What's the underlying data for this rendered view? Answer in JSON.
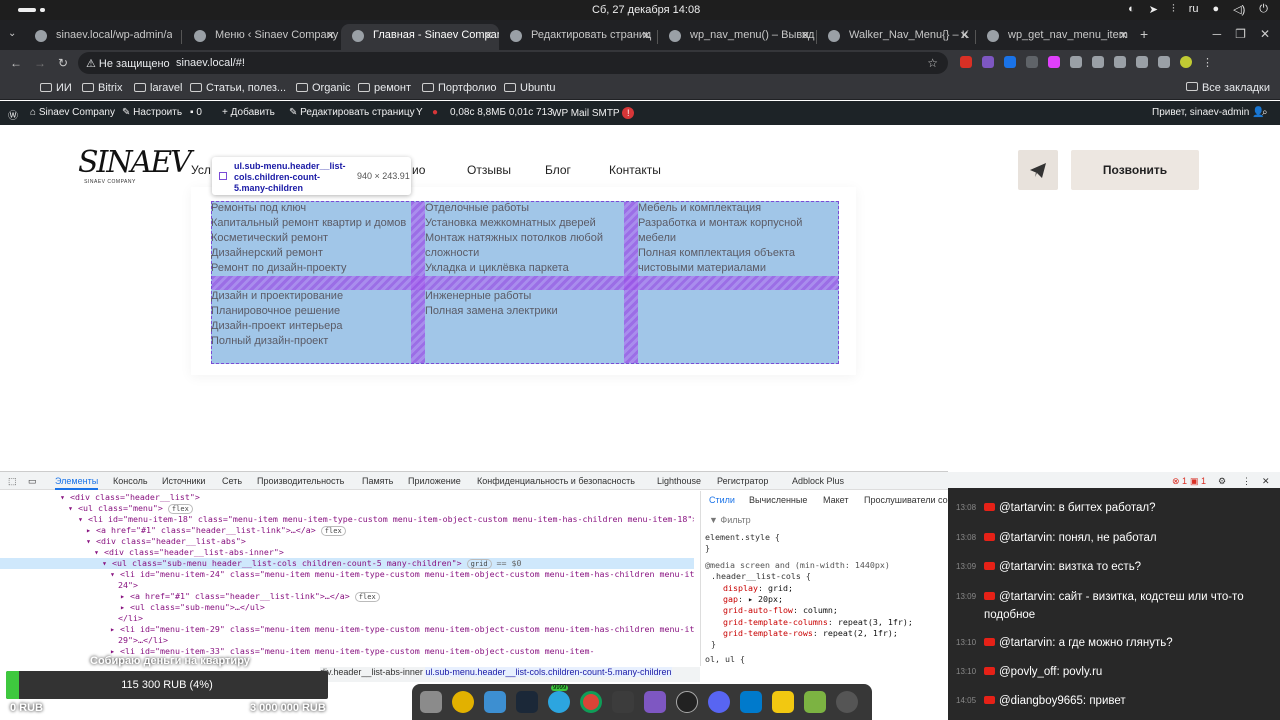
{
  "os": {
    "clock": "Сб, 27 декабря  14:08",
    "lang": "ru"
  },
  "browser": {
    "tabs": [
      {
        "label": "sinaev.local/wp-admin/ad"
      },
      {
        "label": "Меню ‹ Sinaev Company"
      },
      {
        "label": "Главная - Sinaev Compan"
      },
      {
        "label": "Редактировать страниц"
      },
      {
        "label": "wp_nav_menu() – Вывод"
      },
      {
        "label": "Walker_Nav_Menu{} – K"
      },
      {
        "label": "wp_get_nav_menu_item"
      }
    ],
    "security": "Не защищено",
    "url": "sinaev.local/#!",
    "bookmarks": [
      "ИИ",
      "Bitrix",
      "laravel",
      "Статьи, полез...",
      "Organic",
      "ремонт",
      "Портфолио",
      "Ubuntu"
    ],
    "all_bookmarks": "Все закладки"
  },
  "wpbar": {
    "site": "Sinaev Company",
    "customize": "Настроить",
    "comments": "0",
    "add": "Добавить",
    "edit": "Редактировать страницу",
    "stats": "0,08с  8,8МБ  0,01с  713",
    "smtp": "WP Mail SMTP",
    "smtp_badge": "!",
    "greeting": "Привет, sinaev-admin"
  },
  "site": {
    "logo": "SINAEV",
    "logo_sub": "SINAEV COMPANY",
    "nav": [
      "Усл",
      "ио",
      "Отзывы",
      "Блог",
      "Контакты"
    ],
    "call_button": "Позвонить",
    "submenu": {
      "col1_top": [
        "Ремонты под ключ",
        "Капитальный ремонт квартир и домов",
        "Косметический ремонт",
        "Дизайнерский ремонт",
        "Ремонт по дизайн-проекту"
      ],
      "col2_top": [
        "Отделочные работы",
        "Установка межкомнатных дверей",
        "Монтаж натяжных потолков любой",
        "сложности",
        "Укладка и циклёвка паркета"
      ],
      "col3_top": [
        "Мебель и комплектация",
        "Разработка и монтаж корпусной",
        "мебели",
        "Полная комплектация объекта",
        "чистовыми материалами"
      ],
      "col1_bottom": [
        "Дизайн и проектирование",
        "Планировочное решение",
        "Дизайн-проект интерьера",
        "Полный дизайн-проект"
      ],
      "col2_bottom": [
        "Инженерные работы",
        "Полная замена электрики"
      ]
    },
    "tooltip": {
      "selector": "ul.sub-menu.header__list-cols.children-count-5.many-children",
      "size": "940 × 243.91"
    }
  },
  "devtools": {
    "tabs": [
      "Элементы",
      "Консоль",
      "Источники",
      "Сеть",
      "Производительность",
      "Память",
      "Приложение",
      "Конфиденциальность и безопасность",
      "Lighthouse",
      "Регистратор",
      "Adblock Plus"
    ],
    "errors": "1",
    "warnings": "1",
    "dom_lines": [
      "<div class=\"header__list\">",
      "<ul class=\"menu\">",
      "<li id=\"menu-item-18\" class=\"menu-item menu-item-type-custom menu-item-object-custom menu-item-has-children menu-item-18\">",
      "<a href=\"#1\" class=\"header__list-link\">…</a>",
      "<div class=\"header__list-abs\">",
      "<div class=\"header__list-abs-inner\">",
      "<ul class=\"sub-menu header__list-cols children-count-5 many-children\">",
      "<li id=\"menu-item-24\" class=\"menu-item menu-item-type-custom menu-item-object-custom menu-item-has-children menu-item-",
      "24\">",
      "<a href=\"#1\" class=\"header__list-link\">…</a>",
      "<ul class=\"sub-menu\">…</ul>",
      "</li>",
      "<li id=\"menu-item-29\" class=\"menu-item menu-item-type-custom menu-item-object-custom menu-item-has-children menu-item-",
      "29\">…</li>",
      "<li id=\"menu-item-33\" class=\"menu-item menu-item-type-custom menu-item-object-custom menu-item-"
    ],
    "pill_flex": "flex",
    "pill_grid": "grid",
    "eq": "== $0",
    "styles_tabs": [
      "Стили",
      "Вычисленные",
      "Макет",
      "Прослушиватели со"
    ],
    "filter": "Фильтр",
    "element_style": "element.style {",
    "close_brace": "}",
    "media": "@media screen and (min-width: 1440px)",
    "selector": ".header__list-cols {",
    "props": [
      {
        "name": "display",
        "value": "grid;"
      },
      {
        "name": "gap",
        "value": "▸ 20px;"
      },
      {
        "name": "grid-auto-flow",
        "value": "column;"
      },
      {
        "name": "grid-template-columns",
        "value": "repeat(3, 1fr);"
      },
      {
        "name": "grid-template-rows",
        "value": "repeat(2, 1fr);"
      }
    ],
    "next_rule": "ol, ul {",
    "crumbs": [
      "div.header__list-abs-inner",
      "ul.sub-menu.header__list-cols.children-count-5.many-children"
    ]
  },
  "chat": [
    {
      "time": "13:08",
      "text": "@tartarvin: в бигтех работал?"
    },
    {
      "time": "13:08",
      "text": "@tartarvin: понял, не работал"
    },
    {
      "time": "13:09",
      "text": "@tartarvin: визтка то есть?"
    },
    {
      "time": "13:09",
      "text": "@tartarvin: сайт - визитка, кодстеш или что-то подобное"
    },
    {
      "time": "13:10",
      "text": "@tartarvin: а где можно глянуть?"
    },
    {
      "time": "13:10",
      "text": "@povly_off: povly.ru"
    },
    {
      "time": "14:05",
      "text": "@diangboy9665: привет"
    }
  ],
  "donation": {
    "title": "Собираю деньги на квартиру",
    "current": "115 300 RUB (4%)",
    "progress": 0.04,
    "min": "0 RUB",
    "max": "3 000 000 RUB"
  },
  "dock": {
    "badge": "9999"
  },
  "colors": {
    "grid_overlay": "#6fa8dc",
    "grid_gap": "#9950e6",
    "devtools_accent": "#1a73e8"
  }
}
